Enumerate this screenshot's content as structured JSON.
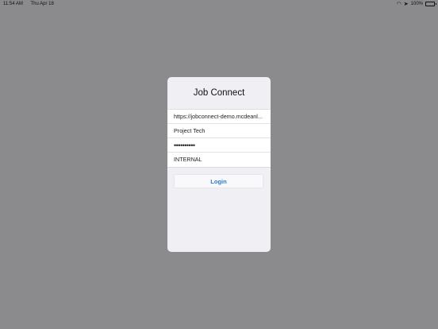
{
  "status_bar": {
    "time": "11:54 AM",
    "date": "Thu Apr 18",
    "battery": "100%",
    "wifi_icon": "wifi-icon",
    "location_icon": "location-icon"
  },
  "login": {
    "title": "Job Connect",
    "fields": {
      "server_url": "https://jobconnect-demo.mcdeanl...",
      "username": "Project Tech",
      "password": "••••••••••",
      "domain": "INTERNAL"
    },
    "login_button_label": "Login"
  },
  "colors": {
    "background": "#8b8b8d",
    "panel": "#efeff4",
    "accent": "#2f7ad1"
  }
}
